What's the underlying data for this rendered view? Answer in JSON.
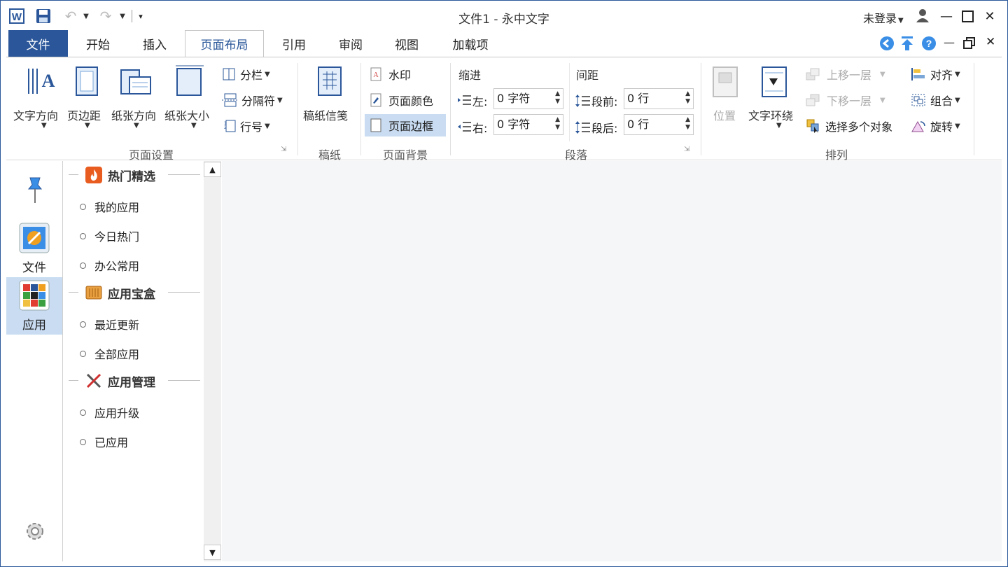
{
  "title": "文件1 - 永中文字",
  "user": {
    "login_label": "未登录"
  },
  "tabs": [
    "文件",
    "开始",
    "插入",
    "页面布局",
    "引用",
    "审阅",
    "视图",
    "加载项"
  ],
  "ribbon": {
    "page_setup": {
      "text_direction": "文字方向",
      "margins": "页边距",
      "orientation": "纸张方向",
      "size": "纸张大小",
      "columns": "分栏",
      "breaks": "分隔符",
      "line_numbers": "行号",
      "group_label": "页面设置"
    },
    "paper": {
      "stationery": "稿纸信笺",
      "group_label": "稿纸"
    },
    "background": {
      "watermark": "水印",
      "page_color": "页面颜色",
      "page_border": "页面边框",
      "group_label": "页面背景"
    },
    "paragraph": {
      "indent_label": "缩进",
      "spacing_label": "间距",
      "left_label": "左:",
      "right_label": "右:",
      "before_label": "段前:",
      "after_label": "段后:",
      "left_value": "0 字符",
      "right_value": "0 字符",
      "before_value": "0 行",
      "after_value": "0 行",
      "group_label": "段落"
    },
    "arrange": {
      "position": "位置",
      "wrap": "文字环绕",
      "bring_forward": "上移一层",
      "send_backward": "下移一层",
      "select_objects": "选择多个对象",
      "align": "对齐",
      "group": "组合",
      "rotate": "旋转",
      "group_label": "排列"
    }
  },
  "sidebar": {
    "file_label": "文件",
    "apps_label": "应用"
  },
  "panel": {
    "hot": {
      "title": "热门精选",
      "items": [
        "我的应用",
        "今日热门",
        "办公常用"
      ]
    },
    "box": {
      "title": "应用宝盒",
      "items": [
        "最近更新",
        "全部应用"
      ]
    },
    "manage": {
      "title": "应用管理",
      "items": [
        "应用升级",
        "已应用"
      ]
    }
  },
  "colors": {
    "accent": "#2b579a",
    "content_bg": "#f5f6f8",
    "selected_bg": "#c9dcf2"
  }
}
